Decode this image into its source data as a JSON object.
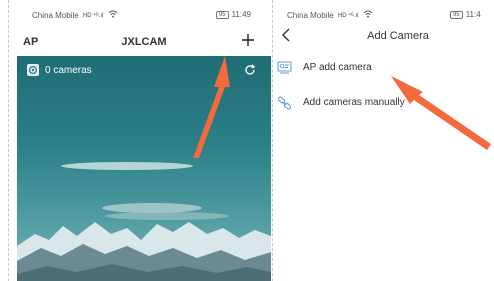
{
  "left": {
    "status": {
      "carrier": "China Mobile",
      "signal": "HD ⁴ᴳ.ıl",
      "battery": "95",
      "time": "11:49"
    },
    "appbar": {
      "left_label": "AP",
      "title": "JXLCAM",
      "add_icon": "plus-icon"
    },
    "camera_list": {
      "count_label": "0 cameras",
      "icon": "camera-icon",
      "refresh_icon": "refresh-icon"
    }
  },
  "right": {
    "status": {
      "carrier": "China Mobile",
      "signal": "HD ⁴ᴳ.ıl",
      "battery": "95",
      "time": "11:4"
    },
    "appbar": {
      "back_icon": "chevron-left-icon",
      "title": "Add Camera"
    },
    "options": [
      {
        "label": "AP add camera",
        "icon": "ap-camera-icon"
      },
      {
        "label": "Add cameras manually",
        "icon": "link-icon"
      }
    ]
  },
  "annotation": {
    "arrow_color": "#f26a3e"
  },
  "colors": {
    "sky_top": "#1f6c74",
    "accent_icon": "#5b9bd5",
    "arrow": "#f26a3e"
  }
}
